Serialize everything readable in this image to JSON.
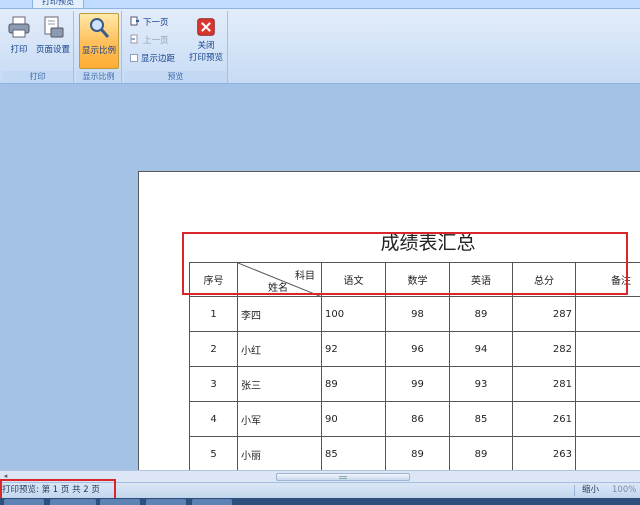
{
  "ribbon": {
    "active_tab": "打印预览",
    "groups": [
      {
        "label": "打印",
        "buttons": [
          {
            "label": "打印"
          },
          {
            "label": "页面设置"
          }
        ]
      },
      {
        "label": "显示比例",
        "buttons": [
          {
            "label": "显示比例"
          }
        ]
      },
      {
        "label": "预览",
        "small_buttons": [
          {
            "label": "下一页"
          },
          {
            "label": "上一页"
          },
          {
            "label": "显示边距"
          }
        ],
        "close_label_1": "关闭",
        "close_label_2": "打印预览"
      }
    ]
  },
  "document": {
    "title": "成绩表汇总",
    "header": {
      "seq": "序号",
      "subject": "科目",
      "name": "姓名",
      "cols": [
        "语文",
        "数学",
        "英语",
        "总分",
        "备注"
      ]
    },
    "rows": [
      {
        "seq": "1",
        "name": "李四",
        "chinese": "100",
        "math": "98",
        "english": "89",
        "total": "287"
      },
      {
        "seq": "2",
        "name": "小红",
        "chinese": "92",
        "math": "96",
        "english": "94",
        "total": "282"
      },
      {
        "seq": "3",
        "name": "张三",
        "chinese": "89",
        "math": "99",
        "english": "93",
        "total": "281"
      },
      {
        "seq": "4",
        "name": "小军",
        "chinese": "90",
        "math": "86",
        "english": "85",
        "total": "261"
      },
      {
        "seq": "5",
        "name": "小丽",
        "chinese": "85",
        "math": "89",
        "english": "89",
        "total": "263"
      }
    ]
  },
  "status": {
    "left": "打印预览: 第 1 页  共 2 页",
    "zoom_out": "缩小",
    "zoom_value": "100%"
  },
  "colors": {
    "highlight": "#d9262b",
    "ribbon_bg": "#dbe8f8",
    "workspace_bg": "#a4c2e6"
  }
}
